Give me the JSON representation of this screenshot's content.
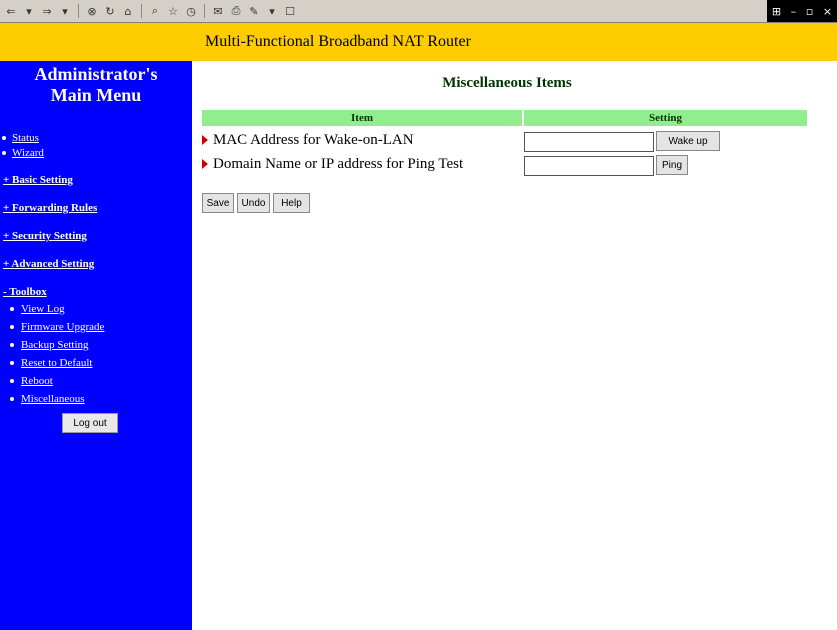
{
  "toolbar": {
    "icons": [
      "back-icon",
      "forward-icon",
      "stop-icon",
      "refresh-icon",
      "home-icon",
      "search-icon",
      "favorites-icon",
      "history-icon",
      "mail-icon",
      "print-icon",
      "edit-icon",
      "discuss-icon"
    ],
    "window_buttons": [
      "minimize",
      "maximize",
      "close"
    ]
  },
  "banner": {
    "title": "Multi-Functional Broadband NAT Router"
  },
  "sidebar": {
    "title_line1": "Administrator's",
    "title_line2": "Main Menu",
    "links": {
      "status": "Status",
      "wizard": "Wizard"
    },
    "sections": {
      "basic": "+ Basic Setting",
      "forwarding": "+ Forwarding Rules",
      "security": "+ Security Setting",
      "advanced": "+ Advanced Setting",
      "toolbox": "- Toolbox"
    },
    "toolbox_items": [
      "View Log",
      "Firmware Upgrade",
      "Backup Setting",
      "Reset to Default",
      "Reboot",
      "Miscellaneous"
    ],
    "logout_label": "Log out"
  },
  "main": {
    "title": "Miscellaneous Items",
    "headers": {
      "item": "Item",
      "setting": "Setting"
    },
    "rows": [
      {
        "label": "MAC Address for Wake-on-LAN",
        "value": "",
        "button": "Wake up"
      },
      {
        "label": "Domain Name or IP address for Ping Test",
        "value": "",
        "button": "Ping"
      }
    ],
    "actions": {
      "save": "Save",
      "undo": "Undo",
      "help": "Help"
    }
  }
}
